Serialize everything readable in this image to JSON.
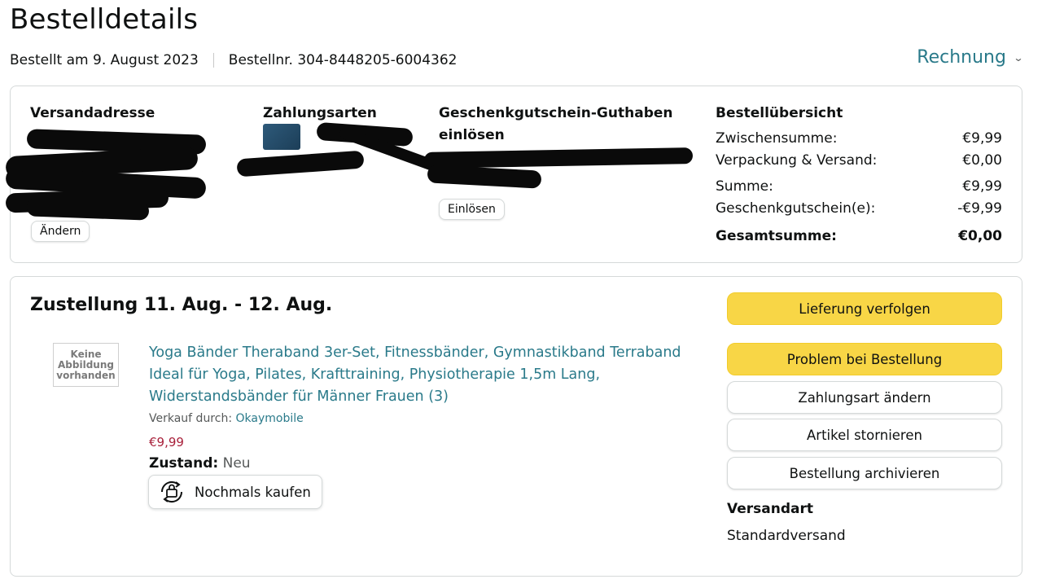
{
  "header": {
    "title": "Bestelldetails",
    "ordered_on": "Bestellt am 9. August 2023",
    "order_number": "Bestellnr. 304-8448205-6004362",
    "invoice_label": "Rechnung"
  },
  "overview": {
    "shipping_address_heading": "Versandadresse",
    "change_label": "Ändern",
    "payment_heading": "Zahlungsarten",
    "giftcard_heading_line1": "Geschenkgutschein-Guthaben",
    "giftcard_heading_line2": "einlösen",
    "redeem_label": "Einlösen",
    "summary_heading": "Bestellübersicht",
    "summary_rows": [
      {
        "label": "Zwischensumme:",
        "value": "€9,99"
      },
      {
        "label": "Verpackung & Versand:",
        "value": "€0,00"
      },
      {
        "label": "Summe:",
        "value": "€9,99"
      },
      {
        "label": "Geschenkgutschein(e):",
        "value": "-€9,99"
      },
      {
        "label": "Gesamtsumme:",
        "value": "€0,00"
      }
    ]
  },
  "shipment": {
    "delivery_title": "Zustellung 11. Aug. - 12. Aug.",
    "no_image_text": "Keine Abbildung vorhanden",
    "product_title": "Yoga Bänder Theraband 3er-Set, Fitnessbänder, Gymnastikband Terraband Ideal für Yoga, Pilates, Krafttraining, Physiotherapie 1,5m Lang, Widerstandsbänder für Männer Frauen (3)",
    "sold_by_label": "Verkauf durch:",
    "seller_name": "Okaymobile",
    "price": "€9,99",
    "condition_label": "Zustand:",
    "condition_value": "Neu",
    "buy_again_label": "Nochmals kaufen",
    "actions": {
      "track": "Lieferung verfolgen",
      "problem": "Problem bei Bestellung",
      "change_payment": "Zahlungsart ändern",
      "cancel": "Artikel stornieren",
      "archive": "Bestellung archivieren"
    },
    "shipping_method_heading": "Versandart",
    "shipping_method_value": "Standardversand"
  },
  "colors": {
    "link": "#2a7a8a",
    "primary_button": "#f8d646",
    "price": "#a8203a"
  }
}
